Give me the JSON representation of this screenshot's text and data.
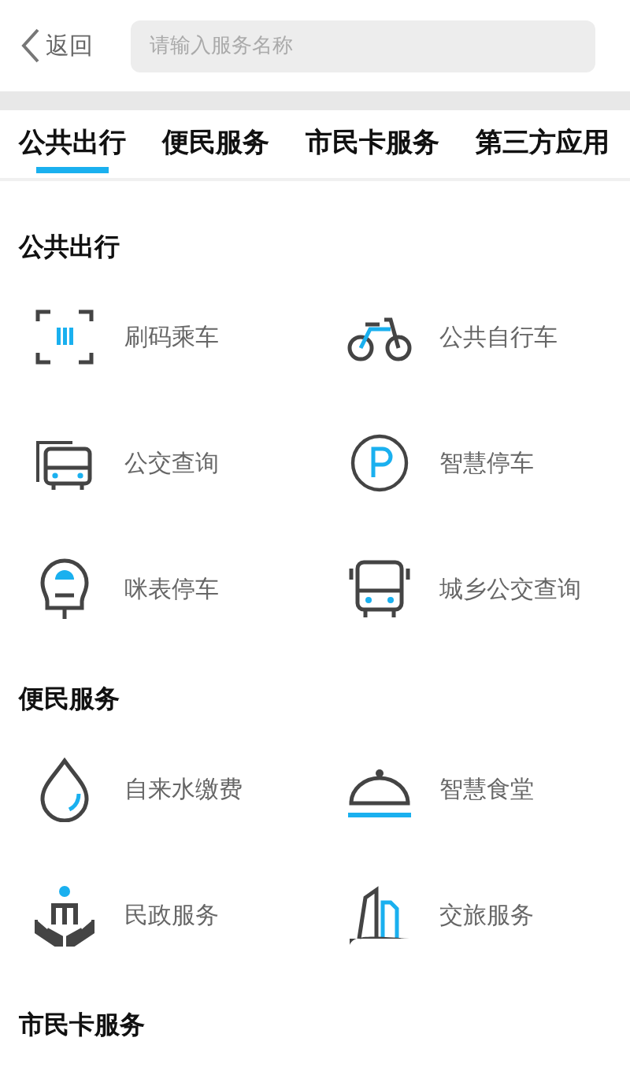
{
  "header": {
    "back_label": "返回",
    "search": {
      "placeholder": "请输入服务名称"
    }
  },
  "tabs": [
    {
      "label": "公共出行",
      "selected": true
    },
    {
      "label": "便民服务",
      "selected": false
    },
    {
      "label": "市民卡服务",
      "selected": false
    },
    {
      "label": "第三方应用",
      "selected": false
    }
  ],
  "sections": [
    {
      "title": "公共出行",
      "items": [
        {
          "label": "刷码乘车"
        },
        {
          "label": "公共自行车"
        },
        {
          "label": "公交查询"
        },
        {
          "label": "智慧停车"
        },
        {
          "label": "咪表停车"
        },
        {
          "label": "城乡公交查询"
        }
      ]
    },
    {
      "title": "便民服务",
      "items": [
        {
          "label": "自来水缴费"
        },
        {
          "label": "智慧食堂"
        },
        {
          "label": "民政服务"
        },
        {
          "label": "交旅服务"
        }
      ]
    },
    {
      "title": "市民卡服务"
    }
  ]
}
